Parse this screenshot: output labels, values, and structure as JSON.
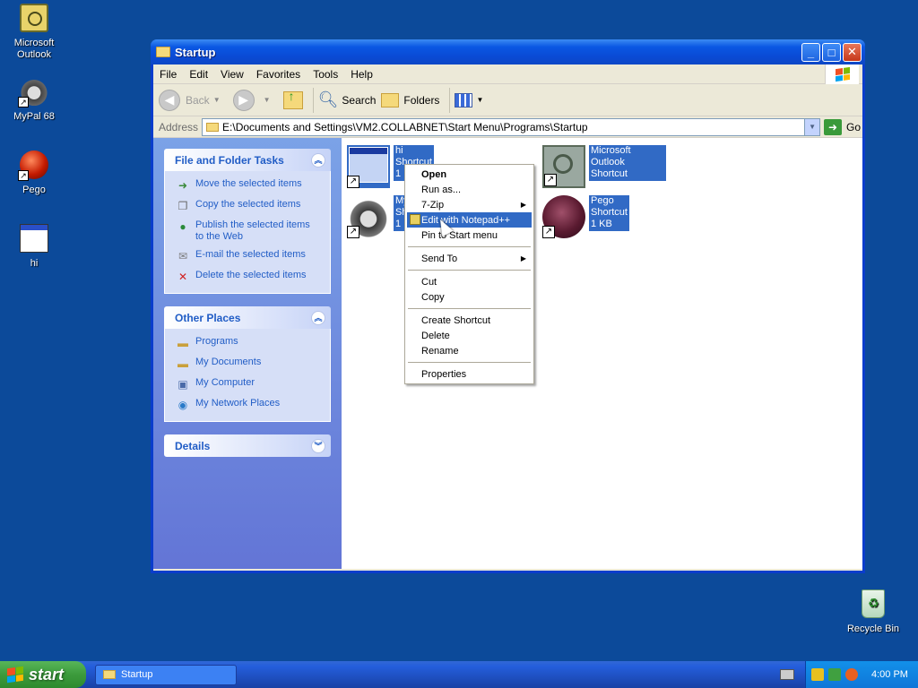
{
  "desktop": {
    "icons": [
      {
        "label": "Microsoft Outlook"
      },
      {
        "label": "MyPal 68"
      },
      {
        "label": "Pego"
      },
      {
        "label": "hi"
      },
      {
        "label": "Recycle Bin"
      }
    ]
  },
  "window": {
    "title": "Startup",
    "menu": [
      "File",
      "Edit",
      "View",
      "Favorites",
      "Tools",
      "Help"
    ],
    "toolbar": {
      "back": "Back",
      "search": "Search",
      "folders": "Folders"
    },
    "address": {
      "label": "Address",
      "value": "E:\\Documents and Settings\\VM2.COLLABNET\\Start Menu\\Programs\\Startup",
      "go": "Go"
    }
  },
  "tasks": {
    "file_folder": {
      "title": "File and Folder Tasks",
      "items": [
        "Move the selected items",
        "Copy the selected items",
        "Publish the selected items to the Web",
        "E-mail the selected items",
        "Delete the selected items"
      ]
    },
    "other_places": {
      "title": "Other Places",
      "items": [
        "Programs",
        "My Documents",
        "My Computer",
        "My Network Places"
      ]
    },
    "details": {
      "title": "Details"
    }
  },
  "files": [
    {
      "name": "hi",
      "type": "Shortcut",
      "size": "1 KB"
    },
    {
      "name": "MyPal 68",
      "type": "Shortcut",
      "size": "1 KB"
    },
    {
      "name": "Microsoft Outlook",
      "type": "Shortcut",
      "size": "1 KB"
    },
    {
      "name": "Pego",
      "type": "Shortcut",
      "size": "1 KB"
    }
  ],
  "files_visible": {
    "hi": {
      "l1": "hi",
      "l2": "Shortcut",
      "l3": "1 KB"
    },
    "mypal": {
      "l1": "My",
      "l2": "Sh",
      "l3": "1 K"
    },
    "outlook": {
      "l1": "Microsoft Outlook",
      "l2": "Shortcut",
      "l3": "1 KB"
    },
    "pego": {
      "l1": "Pego",
      "l2": "Shortcut",
      "l3": "1 KB"
    }
  },
  "context_menu": {
    "open": "Open",
    "run_as": "Run as...",
    "zip": "7-Zip",
    "edit_npp": "Edit with Notepad++",
    "pin": "Pin to Start menu",
    "send_to": "Send To",
    "cut": "Cut",
    "copy": "Copy",
    "create_shortcut": "Create Shortcut",
    "delete": "Delete",
    "rename": "Rename",
    "properties": "Properties"
  },
  "taskbar": {
    "start": "start",
    "task": "Startup",
    "clock": "4:00 PM"
  }
}
